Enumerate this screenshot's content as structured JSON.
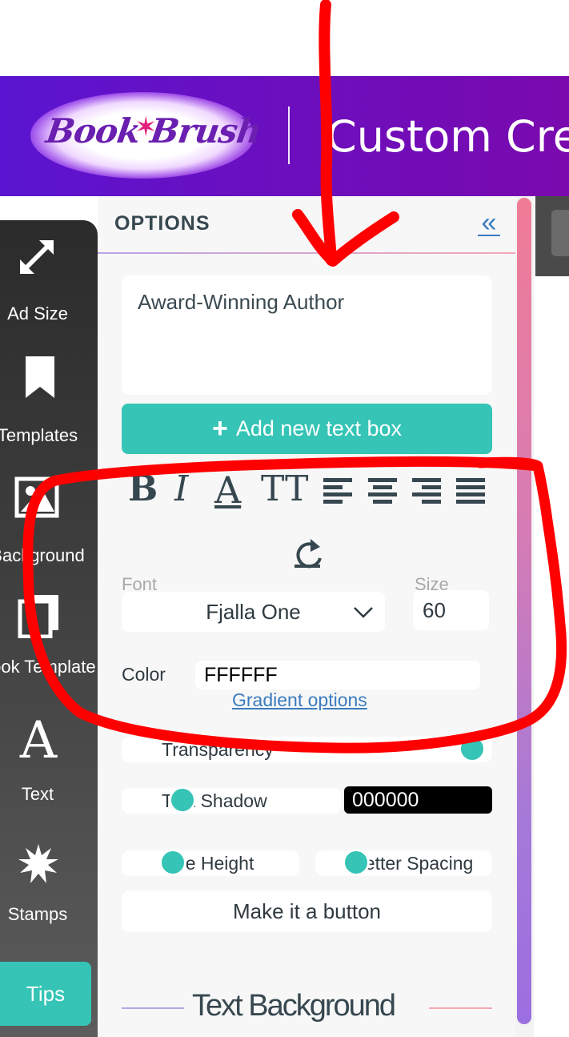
{
  "header": {
    "logo_text": "Book Brush",
    "title": "Custom Crea"
  },
  "sidebar": {
    "items": [
      {
        "label": "Ad Size",
        "icon": "resize-arrows-icon"
      },
      {
        "label": "Templates",
        "icon": "bookmark-icon"
      },
      {
        "label": "Background",
        "icon": "image-icon"
      },
      {
        "label": "Book Template",
        "icon": "stacked-pages-icon"
      },
      {
        "label": "Text",
        "icon": "letter-a-icon"
      },
      {
        "label": "Stamps",
        "icon": "starburst-icon"
      }
    ],
    "tips_label": "Tips"
  },
  "options": {
    "title": "OPTIONS",
    "collapse_glyph": "«",
    "text_value": "Award-Winning Author",
    "add_button_label": "Add new text box",
    "format": {
      "bold": "B",
      "italic": "I",
      "underline": "A",
      "caps": "TT"
    },
    "font_label": "Font",
    "font_value": "Fjalla One",
    "size_label": "Size",
    "size_value": "60",
    "color_label": "Color",
    "color_value": "FFFFFF",
    "gradient_link": "Gradient options",
    "transparency_label": "Transparency",
    "transparency_level": 1.0,
    "text_shadow_label": "Text Shadow",
    "text_shadow_color": "000000",
    "line_height_label": "Line Height",
    "letter_spacing_label": "Letter Spacing",
    "make_button_label": "Make it a button",
    "text_background_heading": "Text Background"
  },
  "colors": {
    "accent": "#35c4b5",
    "header_start": "#5a15d0",
    "header_end": "#7a0aae",
    "annotation": "#ff0000",
    "link": "#3a7bbf"
  }
}
